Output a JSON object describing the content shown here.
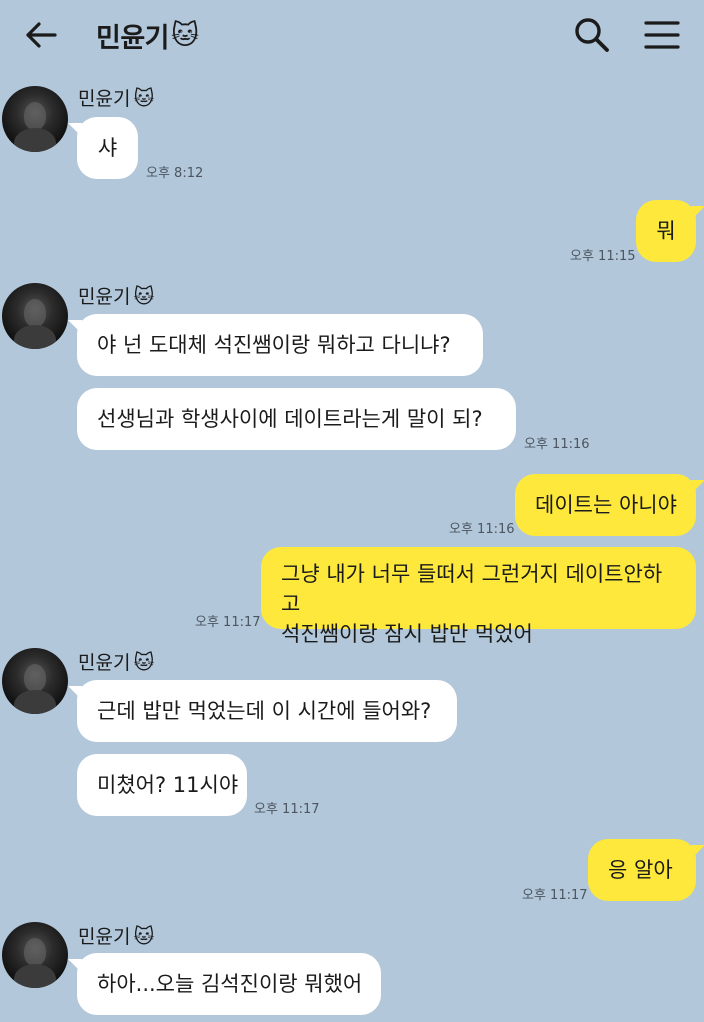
{
  "header": {
    "back_icon": "arrow-left-icon",
    "title": "민윤기",
    "title_emoji": "🐱",
    "search_icon": "search-icon",
    "menu_icon": "hamburger-menu-icon"
  },
  "colors": {
    "background": "#b2c7da",
    "incoming_bubble": "#ffffff",
    "outgoing_bubble": "#fde83b"
  },
  "sender": {
    "name": "민윤기",
    "emoji": "🐱"
  },
  "messages": [
    {
      "text": "샤",
      "time": "오후 8:12"
    },
    {
      "text": "뭐",
      "time": "오후 11:15"
    },
    {
      "text": "야 넌 도대체 석진쌤이랑 뭐하고 다니냐?"
    },
    {
      "text": "선생님과 학생사이에 데이트라는게 말이 되?",
      "time": "오후 11:16"
    },
    {
      "text": "데이트는 아니야",
      "time": "오후 11:16"
    },
    {
      "text_line1": "그냥 내가 너무 들떠서 그런거지 데이트안하고",
      "text_line2": "석진쌤이랑 잠시 밥만 먹었어",
      "time": "오후 11:17"
    },
    {
      "text": "근데 밥만 먹었는데 이 시간에 들어와?"
    },
    {
      "text": "미쳤어? 11시야",
      "time": "오후 11:17"
    },
    {
      "text": "응 알아",
      "time": "오후 11:17"
    },
    {
      "text": "하아...오늘 김석진이랑 뭐했어"
    }
  ]
}
